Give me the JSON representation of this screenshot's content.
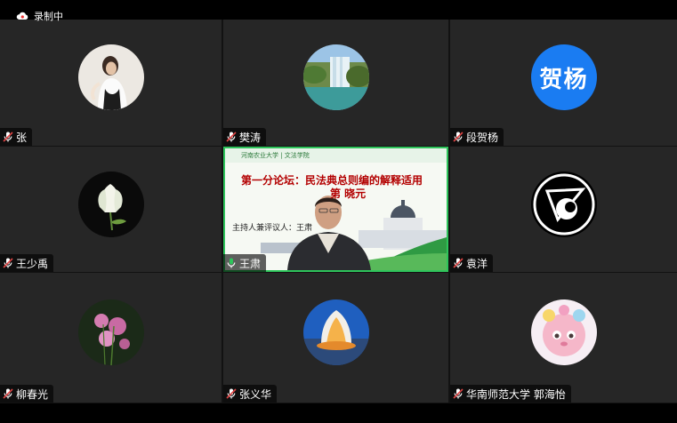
{
  "recording": {
    "label": "录制中",
    "icon": "cloud-icon"
  },
  "participants": [
    {
      "name": "张",
      "avatar": "photo-woman-white-dress",
      "mic": "muted"
    },
    {
      "name": "樊涛",
      "avatar": "photo-waterfall",
      "mic": "muted"
    },
    {
      "name": "段贺杨",
      "avatar_text": "贺杨",
      "avatar_color": "#1a7cf2",
      "mic": "muted"
    },
    {
      "name": "王少禹",
      "avatar": "photo-white-flower",
      "mic": "muted"
    },
    {
      "name": "王肃",
      "mic": "active",
      "slide": {
        "school": "河南农业大学 | 文法学院",
        "title": "第一分论坛：民法典总则编的解释适用",
        "title2": "第   晓元",
        "host": "主持人兼评议人：王肃"
      }
    },
    {
      "name": "袁洋",
      "avatar": "logo-circle-abstract",
      "mic": "muted"
    },
    {
      "name": "柳春光",
      "avatar": "photo-pink-flower",
      "mic": "muted"
    },
    {
      "name": "张义华",
      "avatar": "photo-lotus-building",
      "mic": "muted"
    },
    {
      "name": "华南师范大学 郭海怡",
      "avatar": "cartoon-pink-character",
      "mic": "muted"
    }
  ],
  "colors": {
    "speaking_outline": "#2ec45b",
    "muted_mic": "#e04545"
  }
}
